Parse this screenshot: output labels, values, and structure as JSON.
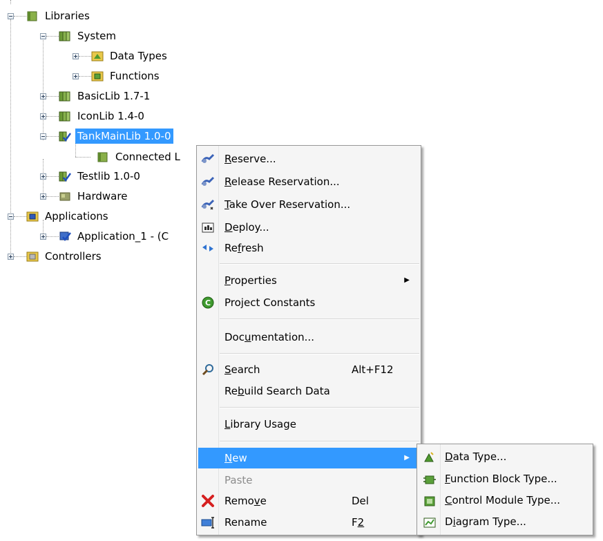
{
  "tree": {
    "nodes": [
      {
        "label": "Libraries"
      },
      {
        "label": "System"
      },
      {
        "label": "Data Types"
      },
      {
        "label": "Functions"
      },
      {
        "label": "BasicLib 1.7-1"
      },
      {
        "label": "IconLib 1.4-0"
      },
      {
        "label": "TankMainLib 1.0-0"
      },
      {
        "label": "Connected L"
      },
      {
        "label": "Testlib 1.0-0"
      },
      {
        "label": "Hardware"
      },
      {
        "label": "Applications"
      },
      {
        "label": "Application_1 - (C"
      },
      {
        "label": "Controllers"
      }
    ]
  },
  "context_menu": {
    "items": [
      {
        "pre": "",
        "key": "R",
        "post": "eserve..."
      },
      {
        "pre": "",
        "key": "R",
        "post": "elease Reservation..."
      },
      {
        "pre": "",
        "key": "T",
        "post": "ake Over Reservation..."
      },
      {
        "pre": "",
        "key": "D",
        "post": "eploy..."
      },
      {
        "pre": "Re",
        "key": "f",
        "post": "resh"
      },
      {
        "pre": "",
        "key": "P",
        "post": "roperties"
      },
      {
        "pre": "Project Constants",
        "key": "",
        "post": ""
      },
      {
        "pre": "Doc",
        "key": "u",
        "post": "mentation..."
      },
      {
        "pre": "",
        "key": "S",
        "post": "earch",
        "shortcut": "Alt+F12"
      },
      {
        "pre": "Re",
        "key": "b",
        "post": "uild Search Data"
      },
      {
        "pre": "",
        "key": "L",
        "post": "ibrary Usage"
      },
      {
        "pre": "",
        "key": "N",
        "post": "ew"
      },
      {
        "pre": "Paste",
        "key": "",
        "post": ""
      },
      {
        "pre": "Remo",
        "key": "v",
        "post": "e",
        "shortcut": "Del"
      },
      {
        "pre": "Rename",
        "key": "",
        "post": "",
        "shortcut_pre": "F",
        "shortcut_key": "2"
      }
    ]
  },
  "submenu": {
    "items": [
      {
        "pre": "",
        "key": "D",
        "post": "ata Type..."
      },
      {
        "pre": "",
        "key": "F",
        "post": "unction Block Type..."
      },
      {
        "pre": "",
        "key": "C",
        "post": "ontrol Module Type..."
      },
      {
        "pre": "D",
        "key": "i",
        "post": "agram Type..."
      }
    ]
  },
  "colors": {
    "selection": "#3399ff",
    "menu_background": "#f5f5f5",
    "disabled_text": "#8c8c8c"
  },
  "icons": {
    "library": "library-book-icon",
    "library_checked": "library-checked-icon",
    "folder_data_types": "data-types-icon",
    "folder_functions": "functions-icon",
    "hardware": "hardware-icon",
    "applications": "applications-icon",
    "application": "application-checked-icon",
    "controllers": "controllers-icon",
    "reserve": "reserve-icon",
    "release": "release-reservation-icon",
    "takeover": "take-over-reservation-icon",
    "deploy": "deploy-icon",
    "refresh": "refresh-icon",
    "constants": "project-constants-icon",
    "search": "search-icon",
    "remove": "remove-x-icon",
    "rename": "rename-icon"
  }
}
